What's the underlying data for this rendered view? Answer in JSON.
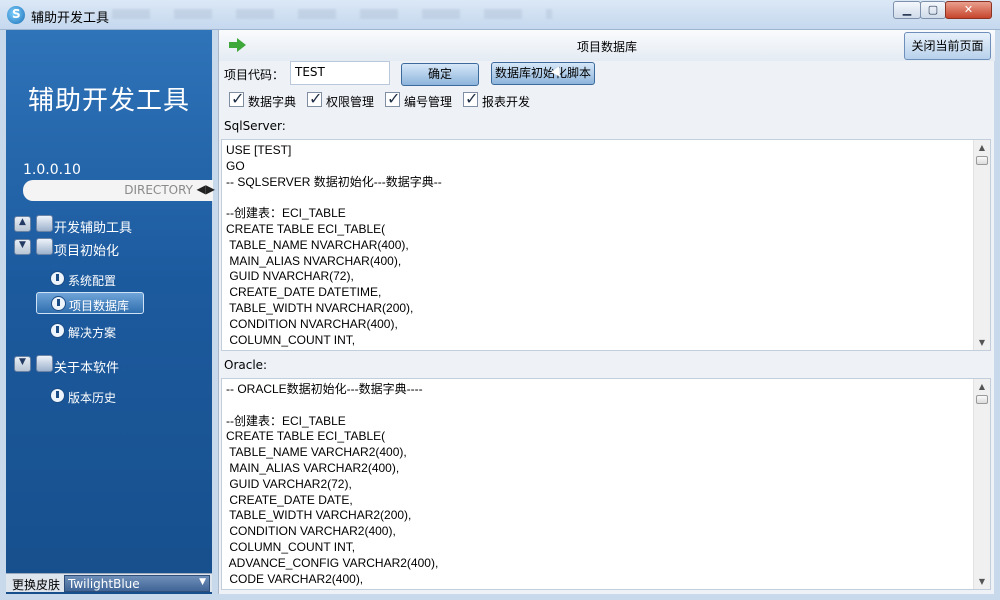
{
  "window": {
    "title": "辅助开发工具",
    "min_glyph": "▁",
    "max_glyph": "▢",
    "close_glyph": "✕"
  },
  "sidebar": {
    "app_name": "辅助开发工具",
    "version": "1.0.0.10",
    "directory_label": "DIRECTORY",
    "directory_arrows": "◀▶",
    "groups": [
      {
        "label": "开发辅助工具",
        "toggle": "▲"
      },
      {
        "label": "项目初始化",
        "toggle": "▼"
      },
      {
        "label": "关于本软件",
        "toggle": "▼"
      }
    ],
    "items": [
      {
        "label": "系统配置"
      },
      {
        "label": "项目数据库"
      },
      {
        "label": "解决方案"
      },
      {
        "label": "版本历史"
      }
    ],
    "skin_label": "更换皮肤",
    "skin_value": "TwilightBlue",
    "skin_arrow": "▼"
  },
  "main": {
    "page_title": "项目数据库",
    "close_page_label": "关闭当前页面",
    "project_code_label": "项目代码：",
    "project_code_value": "TEST",
    "ok_label": "确定",
    "script_label": "数据库初始化脚本",
    "checkboxes": [
      {
        "label": "数据字典",
        "checked": true
      },
      {
        "label": "权限管理",
        "checked": true
      },
      {
        "label": "编号管理",
        "checked": true
      },
      {
        "label": "报表开发",
        "checked": true
      }
    ],
    "sqlserver_label": "SqlServer:",
    "sqlserver_script": "USE [TEST]\nGO\n-- SQLSERVER 数据初始化---数据字典--\n\n--创建表：ECI_TABLE\nCREATE TABLE ECI_TABLE(\n TABLE_NAME NVARCHAR(400),\n MAIN_ALIAS NVARCHAR(400),\n GUID NVARCHAR(72),\n CREATE_DATE DATETIME,\n TABLE_WIDTH NVARCHAR(200),\n CONDITION NVARCHAR(400),\n COLUMN_COUNT INT,",
    "oracle_label": "Oracle:",
    "oracle_script": "-- ORACLE数据初始化---数据字典----\n\n--创建表：ECI_TABLE\nCREATE TABLE ECI_TABLE(\n TABLE_NAME VARCHAR2(400),\n MAIN_ALIAS VARCHAR2(400),\n GUID VARCHAR2(72),\n CREATE_DATE DATE,\n TABLE_WIDTH VARCHAR2(200),\n CONDITION VARCHAR2(400),\n COLUMN_COUNT INT,\n ADVANCE_CONFIG VARCHAR2(400),\n CODE VARCHAR2(400),",
    "scroll_up": "▲",
    "scroll_down": "▼"
  }
}
